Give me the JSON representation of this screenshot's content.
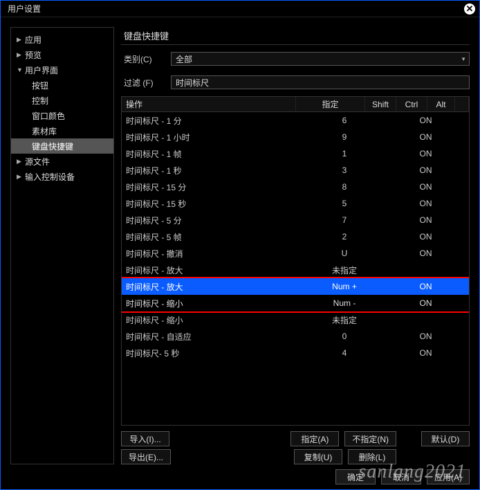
{
  "window": {
    "title": "用户设置"
  },
  "sidebar": {
    "items": [
      {
        "label": "应用",
        "expanded": false,
        "arrow": "▶"
      },
      {
        "label": "预览",
        "expanded": false,
        "arrow": "▶"
      },
      {
        "label": "用户界面",
        "expanded": true,
        "arrow": "▼",
        "children": [
          {
            "label": "按钮"
          },
          {
            "label": "控制"
          },
          {
            "label": "窗口颜色"
          },
          {
            "label": "素材库"
          },
          {
            "label": "键盘快捷键",
            "selected": true
          }
        ]
      },
      {
        "label": "源文件",
        "expanded": false,
        "arrow": "▶"
      },
      {
        "label": "输入控制设备",
        "expanded": false,
        "arrow": "▶"
      }
    ]
  },
  "main": {
    "section_title": "键盘快捷键",
    "category_label": "类别(C)",
    "category_value": "全部",
    "filter_label": "过滤 (F)",
    "filter_value": "时间标尺",
    "columns": {
      "op": "操作",
      "assign": "指定",
      "shift": "Shift",
      "ctrl": "Ctrl",
      "alt": "Alt"
    },
    "rows": [
      {
        "op": "时间标尺 - 1 分",
        "assign": "6",
        "shift": "",
        "ctrl": "ON",
        "alt": ""
      },
      {
        "op": "时间标尺 - 1 小时",
        "assign": "9",
        "shift": "",
        "ctrl": "ON",
        "alt": ""
      },
      {
        "op": "时间标尺 - 1 帧",
        "assign": "1",
        "shift": "",
        "ctrl": "ON",
        "alt": ""
      },
      {
        "op": "时间标尺 - 1 秒",
        "assign": "3",
        "shift": "",
        "ctrl": "ON",
        "alt": ""
      },
      {
        "op": "时间标尺 - 15 分",
        "assign": "8",
        "shift": "",
        "ctrl": "ON",
        "alt": ""
      },
      {
        "op": "时间标尺 - 15 秒",
        "assign": "5",
        "shift": "",
        "ctrl": "ON",
        "alt": ""
      },
      {
        "op": "时间标尺 - 5 分",
        "assign": "7",
        "shift": "",
        "ctrl": "ON",
        "alt": ""
      },
      {
        "op": "时间标尺 - 5 帧",
        "assign": "2",
        "shift": "",
        "ctrl": "ON",
        "alt": ""
      },
      {
        "op": "时间标尺 - 撤消",
        "assign": "U",
        "shift": "",
        "ctrl": "ON",
        "alt": ""
      },
      {
        "op": "时间标尺 - 放大",
        "assign": "未指定",
        "shift": "",
        "ctrl": "",
        "alt": ""
      },
      {
        "op": "时间标尺 - 放大",
        "assign": "Num +",
        "shift": "",
        "ctrl": "ON",
        "alt": "",
        "selected": true
      },
      {
        "op": "时间标尺 - 缩小",
        "assign": "Num -",
        "shift": "",
        "ctrl": "ON",
        "alt": "",
        "hl2": true
      },
      {
        "op": "时间标尺 - 缩小",
        "assign": "未指定",
        "shift": "",
        "ctrl": "",
        "alt": ""
      },
      {
        "op": "时间标尺 - 自适应",
        "assign": "0",
        "shift": "",
        "ctrl": "ON",
        "alt": ""
      },
      {
        "op": "时间标尺- 5 秒",
        "assign": "4",
        "shift": "",
        "ctrl": "ON",
        "alt": ""
      }
    ],
    "buttons": {
      "import": "导入(I)...",
      "export": "导出(E)...",
      "assign": "指定(A)",
      "unassign": "不指定(N)",
      "default": "默认(D)",
      "duplicate": "复制(U)",
      "delete": "删除(L)"
    }
  },
  "footer": {
    "ok": "确定",
    "cancel": "取消",
    "apply": "应用(A)"
  },
  "watermark": "sanlang2021"
}
